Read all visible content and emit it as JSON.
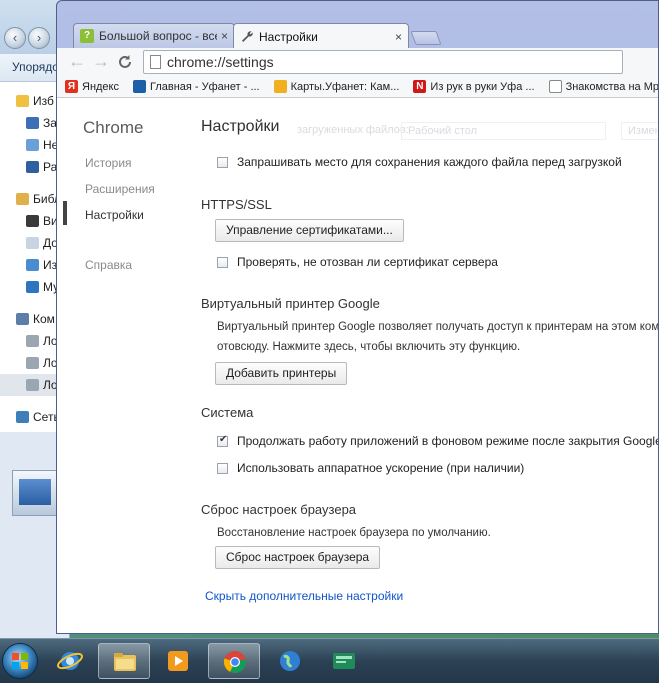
{
  "explorer": {
    "toolbar_label": "Упорядо",
    "tree": [
      {
        "label": "Изб",
        "level": 0,
        "color": "#f0c040"
      },
      {
        "label": "За",
        "level": 1,
        "color": "#3d6fb6"
      },
      {
        "label": "Не",
        "level": 1,
        "color": "#6a9fd8"
      },
      {
        "label": "Ра",
        "level": 1,
        "color": "#2e5f9e"
      },
      {
        "label": "Библ",
        "level": 0,
        "color": "#e0b04a"
      },
      {
        "label": "Ви",
        "level": 1,
        "color": "#3a3a3a"
      },
      {
        "label": "До",
        "level": 1,
        "color": "#c9d4e2"
      },
      {
        "label": "Из",
        "level": 1,
        "color": "#4a8cd0"
      },
      {
        "label": "Му",
        "level": 1,
        "color": "#2f74c0"
      },
      {
        "label": "Ком",
        "level": 0,
        "color": "#5b7fa8"
      },
      {
        "label": "Ло",
        "level": 1,
        "color": "#9aa6b2"
      },
      {
        "label": "Ло",
        "level": 1,
        "color": "#9aa6b2"
      },
      {
        "label": "Ло",
        "level": 1,
        "color": "#9aa6b2"
      },
      {
        "label": "Сеть",
        "level": 0,
        "color": "#3f7fb8"
      }
    ]
  },
  "tabs": {
    "inactive": {
      "title": "Большой вопрос - все во",
      "close": "×"
    },
    "active": {
      "title": "Настройки",
      "close": "×"
    }
  },
  "toolbar": {
    "back": "←",
    "forward": "→",
    "reload": "C",
    "url": "chrome://settings"
  },
  "bookmarks": [
    {
      "label": "Яндекс",
      "icon": "Я",
      "color": "#e0301e"
    },
    {
      "label": "Главная - Уфанет - ...",
      "icon": "",
      "color": "#1c5ea8"
    },
    {
      "label": "Карты.Уфанет: Кам...",
      "icon": "",
      "color": "#f0b020"
    },
    {
      "label": "Из рук в руки Уфа ...",
      "icon": "N",
      "color": "#d01818"
    },
    {
      "label": "Знакомства на Мр...",
      "icon": "",
      "color": "#ffffff"
    }
  ],
  "nav": {
    "brand": "Chrome",
    "items": [
      "История",
      "Расширения",
      "Настройки",
      "Справка"
    ],
    "selected": "Настройки"
  },
  "settings": {
    "page_title": "Настройки",
    "ghost_text": "загруженных файлов:",
    "ghost_field": "Рабочий стол",
    "ghost_button": "Измен",
    "downloads": {
      "ask_location": {
        "label": "Запрашивать место для сохранения каждого файла перед загрузкой",
        "checked": false
      }
    },
    "https": {
      "title": "HTTPS/SSL",
      "manage_certs_button": "Управление сертификатами...",
      "check_revocation": {
        "label": "Проверять, не отозван ли сертификат сервера",
        "checked": false
      }
    },
    "cloud_print": {
      "title": "Виртуальный принтер Google",
      "description_line1": "Виртуальный принтер Google позволяет получать доступ к принтерам на этом компьютере",
      "description_line2": "отовсюду. Нажмите здесь, чтобы включить эту функцию.",
      "add_printers_button": "Добавить принтеры"
    },
    "system": {
      "title": "Система",
      "background_apps": {
        "label": "Продолжать работу приложений в фоновом режиме после закрытия Google Chrome",
        "checked": true
      },
      "hardware_accel": {
        "label": "Использовать аппаратное ускорение (при наличии)",
        "checked": false
      }
    },
    "reset": {
      "title": "Сброс настроек браузера",
      "description": "Восстановление настроек браузера по умолчанию.",
      "reset_button": "Сброс настроек браузера"
    },
    "hide_advanced_link": "Скрыть дополнительные настройки"
  },
  "taskbar": {
    "items": [
      {
        "name": "internet-explorer",
        "active": false
      },
      {
        "name": "file-explorer",
        "active": true
      },
      {
        "name": "media-player",
        "active": false
      },
      {
        "name": "chrome",
        "active": true
      },
      {
        "name": "network-globe",
        "active": false
      },
      {
        "name": "terminal-app",
        "active": false
      }
    ]
  }
}
